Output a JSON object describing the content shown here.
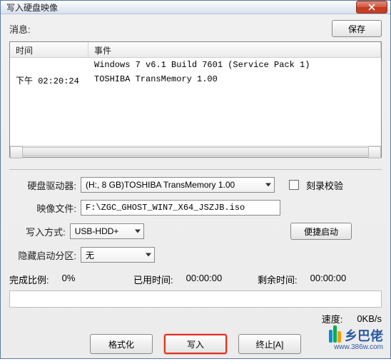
{
  "titlebar": {
    "title": "写入硬盘映像"
  },
  "msg_label": "消息:",
  "save_label": "保存",
  "log": {
    "col_time": "时间",
    "col_event": "事件",
    "rows": [
      {
        "time": "",
        "event": "Windows 7 v6.1 Build 7601 (Service Pack 1)"
      },
      {
        "time": "下午 02:20:24",
        "event": "TOSHIBA TransMemory    1.00"
      }
    ]
  },
  "form": {
    "drive_label": "硬盘驱动器:",
    "drive_value": "(H:, 8 GB)TOSHIBA TransMemory    1.00",
    "verify_label": "刻录校验",
    "image_label": "映像文件:",
    "image_value": "F:\\ZGC_GHOST_WIN7_X64_JSZJB.iso",
    "write_mode_label": "写入方式:",
    "write_mode_value": "USB-HDD+",
    "quick_boot_label": "便捷启动",
    "hidden_partition_label": "隐藏启动分区:",
    "hidden_partition_value": "无"
  },
  "status": {
    "complete_pct_label": "完成比例:",
    "complete_pct_value": "0%",
    "elapsed_label": "已用时间:",
    "elapsed_value": "00:00:00",
    "remaining_label": "剩余时间:",
    "remaining_value": "00:00:00",
    "speed_label": "速度:",
    "speed_value": "0KB/s"
  },
  "buttons": {
    "format": "格式化",
    "write": "写入",
    "terminate": "终止[A]"
  },
  "brand": {
    "name": "乡巴佬",
    "url": "www.386w.com"
  }
}
